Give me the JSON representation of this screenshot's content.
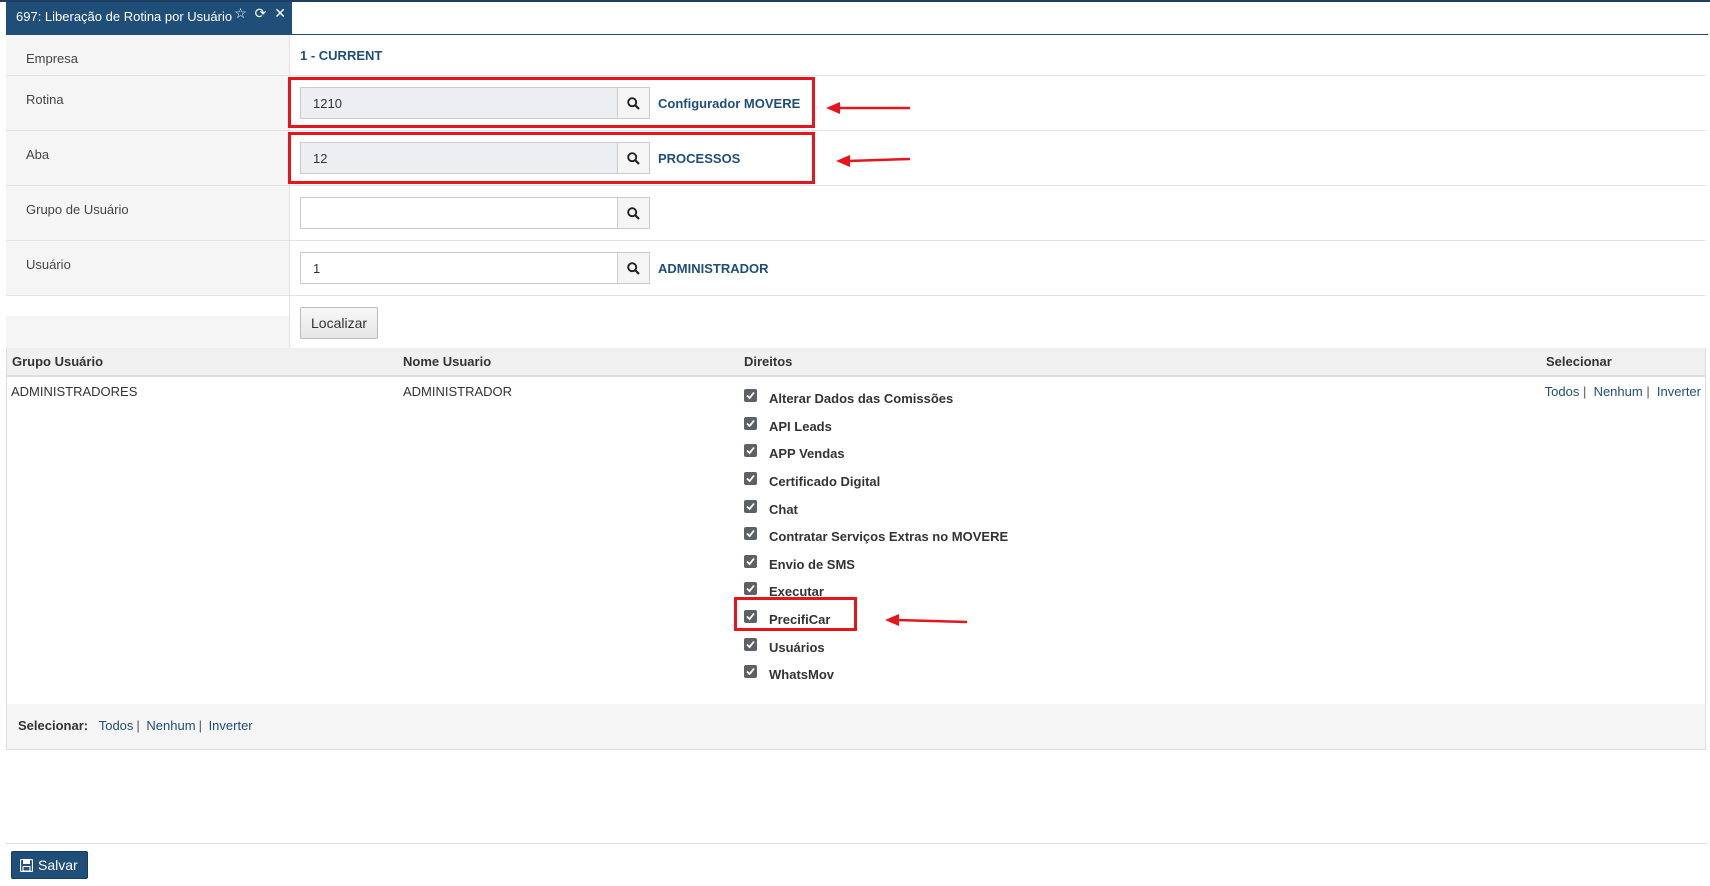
{
  "tab": {
    "title": "697: Liberação de Rotina por Usuário",
    "star_icon": "☆",
    "refresh_icon": "⟳",
    "close_icon": "✕"
  },
  "form": {
    "empresa": {
      "label": "Empresa",
      "value": "1 - CURRENT"
    },
    "rotina": {
      "label": "Rotina",
      "value": "1210",
      "description": "Configurador MOVERE"
    },
    "aba": {
      "label": "Aba",
      "value": "12",
      "description": "PROCESSOS"
    },
    "grupo": {
      "label": "Grupo de Usuário",
      "value": ""
    },
    "usuario": {
      "label": "Usuário",
      "value": "1",
      "description": "ADMINISTRADOR"
    },
    "localizar_label": "Localizar"
  },
  "grid": {
    "headers": {
      "grupo": "Grupo Usuário",
      "nome": "Nome Usuario",
      "direitos": "Direitos",
      "selecionar": "Selecionar"
    },
    "row": {
      "grupo": "ADMINISTRADORES",
      "nome": "ADMINISTRADOR",
      "rights": [
        {
          "label": "Alterar Dados das Comissões",
          "checked": true
        },
        {
          "label": "API Leads",
          "checked": true
        },
        {
          "label": "APP Vendas",
          "checked": true
        },
        {
          "label": "Certificado Digital",
          "checked": true
        },
        {
          "label": "Chat",
          "checked": true
        },
        {
          "label": "Contratar Serviços Extras no MOVERE",
          "checked": true
        },
        {
          "label": "Envio de SMS",
          "checked": true
        },
        {
          "label": "Executar",
          "checked": true
        },
        {
          "label": "PrecifiCar",
          "checked": true
        },
        {
          "label": "Usuários",
          "checked": true
        },
        {
          "label": "WhatsMov",
          "checked": true
        }
      ],
      "select_links": {
        "todos": "Todos",
        "nenhum": "Nenhum",
        "inverter": "Inverter"
      }
    },
    "footer": {
      "label": "Selecionar:",
      "todos": "Todos",
      "nenhum": "Nenhum",
      "inverter": "Inverter"
    }
  },
  "actions": {
    "save_label": "Salvar"
  },
  "colors": {
    "primary": "#1f4e79",
    "highlight": "#e8141b",
    "checkbox": "#5d6166"
  }
}
